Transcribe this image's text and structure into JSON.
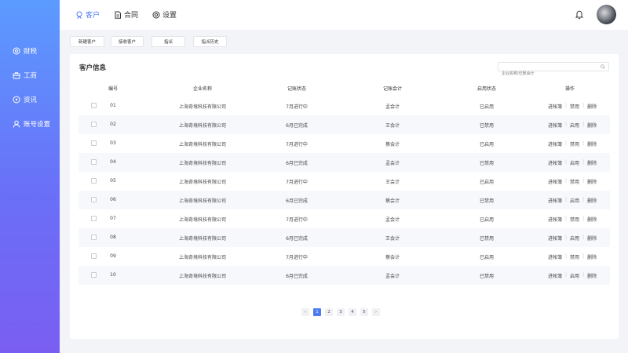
{
  "sidebar": {
    "items": [
      {
        "label": "财税",
        "icon": "target-icon"
      },
      {
        "label": "工商",
        "icon": "briefcase-icon"
      },
      {
        "label": "资讯",
        "icon": "play-circle-icon"
      },
      {
        "label": "账号设置",
        "icon": "user-icon"
      }
    ]
  },
  "header": {
    "tabs": [
      {
        "label": "客户",
        "icon": "customer-icon",
        "active": true
      },
      {
        "label": "合同",
        "icon": "document-icon",
        "active": false
      },
      {
        "label": "设置",
        "icon": "settings-icon",
        "active": false
      }
    ]
  },
  "toolbar": {
    "new_customer": "新建客户",
    "receive_customer": "接收客户",
    "assign": "指派",
    "assign_history": "指派历史"
  },
  "main": {
    "title": "客户信息",
    "search_placeholder": "企业名称/记账会计",
    "columns": [
      "编号",
      "企业名称",
      "记账状态",
      "记账会计",
      "启用状态",
      "操作"
    ],
    "rows": [
      {
        "no": "01",
        "company": "上海奇境科技有限公司",
        "status": "7月进行中",
        "accountant": "孟会计",
        "enabled": "已启用",
        "toggle": "禁用"
      },
      {
        "no": "02",
        "company": "上海奇境科技有限公司",
        "status": "6月已完成",
        "accountant": "王会计",
        "enabled": "已禁用",
        "toggle": "启用"
      },
      {
        "no": "03",
        "company": "上海奇境科技有限公司",
        "status": "7月进行中",
        "accountant": "蔡会计",
        "enabled": "已启用",
        "toggle": "禁用"
      },
      {
        "no": "04",
        "company": "上海奇境科技有限公司",
        "status": "6月已完成",
        "accountant": "孟会计",
        "enabled": "已禁用",
        "toggle": "启用"
      },
      {
        "no": "05",
        "company": "上海奇境科技有限公司",
        "status": "7月进行中",
        "accountant": "王会计",
        "enabled": "已启用",
        "toggle": "禁用"
      },
      {
        "no": "06",
        "company": "上海奇境科技有限公司",
        "status": "6月已完成",
        "accountant": "蔡会计",
        "enabled": "已禁用",
        "toggle": "启用"
      },
      {
        "no": "07",
        "company": "上海奇境科技有限公司",
        "status": "7月进行中",
        "accountant": "孟会计",
        "enabled": "已启用",
        "toggle": "禁用"
      },
      {
        "no": "08",
        "company": "上海奇境科技有限公司",
        "status": "6月已完成",
        "accountant": "王会计",
        "enabled": "已禁用",
        "toggle": "启用"
      },
      {
        "no": "09",
        "company": "上海奇境科技有限公司",
        "status": "7月进行中",
        "accountant": "蔡会计",
        "enabled": "已启用",
        "toggle": "禁用"
      },
      {
        "no": "10",
        "company": "上海奇境科技有限公司",
        "status": "6月已完成",
        "accountant": "孟会计",
        "enabled": "已禁用",
        "toggle": "启用"
      }
    ],
    "op_ledger": "进帐簿",
    "op_delete": "删除"
  },
  "pagination": {
    "prev": "‹",
    "next": "›",
    "pages": [
      "1",
      "2",
      "3",
      "4",
      "5"
    ],
    "current": "1"
  },
  "colors": {
    "accent": "#4c7bf3",
    "sidebar_top": "#5b9bff",
    "sidebar_bottom": "#7a5ef2"
  }
}
